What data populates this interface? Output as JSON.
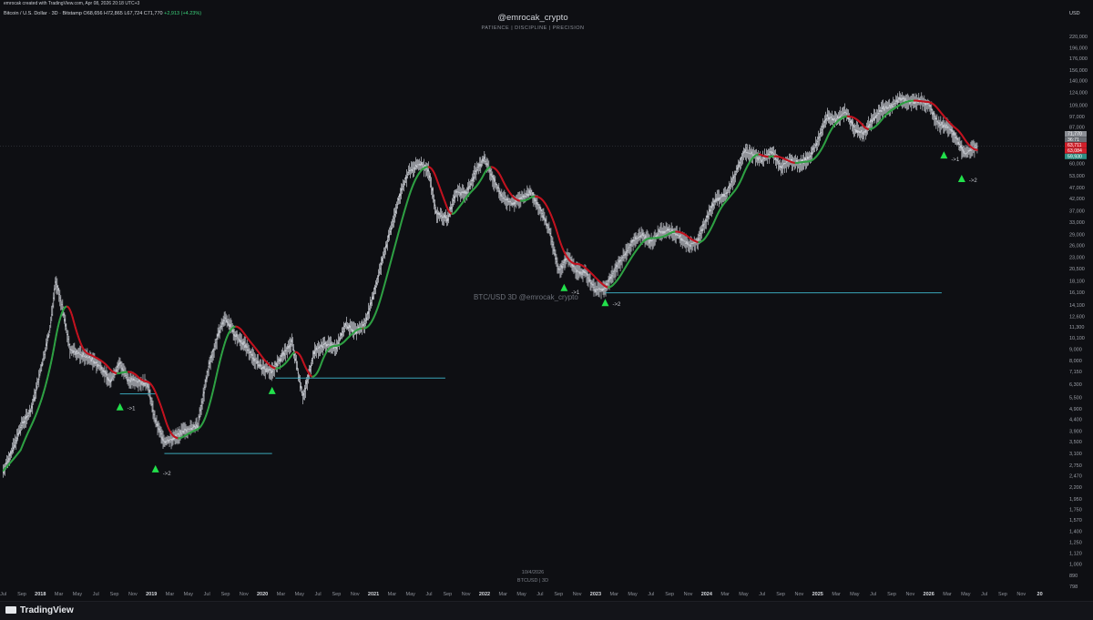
{
  "top_bar": {
    "caption": "emrocak created with TradingView.com, Apr 08, 2026 20:18 UTC+3"
  },
  "headline": {
    "symbol": "Bitcoin / U.S. Dollar · 3D · Bitstamp",
    "ohlc": "O68,656 H72,865 L67,724 C71,770",
    "change": "+2,913 (+4.23%)"
  },
  "watermark": {
    "title": "@emrocak_crypto",
    "subtitle": "PATIENCE | DISCIPLINE | PRECISION"
  },
  "center_mark": "BTC/USD 3D  @emrocak_crypto",
  "date_mark": {
    "date": "10/4/2026",
    "symbol": "BTCUSD | 3D"
  },
  "currency": "USD",
  "footer": {
    "brand": "TradingView"
  },
  "colors": {
    "up": "#3bd07a",
    "bull_ma": "#2ea043",
    "bear_ma": "#c1121f",
    "level": "#3aa6b9",
    "marker": "#22e04b",
    "candles": "#c8cbd2"
  },
  "chart_data": {
    "type": "line",
    "scale": "log",
    "ylim": [
      720,
      280000
    ],
    "y_ticks": [
      "798",
      "890",
      "1,000",
      "1,120",
      "1,250",
      "1,400",
      "1,570",
      "1,750",
      "1,950",
      "2,200",
      "2,470",
      "2,750",
      "3,100",
      "3,500",
      "3,900",
      "4,400",
      "4,900",
      "5,500",
      "6,300",
      "7,150",
      "8,000",
      "9,000",
      "10,100",
      "11,300",
      "12,600",
      "14,100",
      "16,100",
      "18,100",
      "20,500",
      "23,000",
      "26,000",
      "29,000",
      "33,000",
      "37,000",
      "42,000",
      "47,000",
      "53,000",
      "60,000",
      "68,000",
      "77,000",
      "87,000",
      "97,000",
      "109,000",
      "124,000",
      "140,000",
      "156,000",
      "176,000",
      "196,000",
      "220,000"
    ],
    "x_ticks": [
      "Jul",
      "Sep",
      "2018",
      "Mar",
      "May",
      "Jul",
      "Sep",
      "Nov",
      "2019",
      "Mar",
      "May",
      "Jul",
      "Sep",
      "Nov",
      "2020",
      "Mar",
      "May",
      "Jul",
      "Sep",
      "Nov",
      "2021",
      "Mar",
      "May",
      "Jul",
      "Sep",
      "Nov",
      "2022",
      "Mar",
      "May",
      "Jul",
      "Sep",
      "Nov",
      "2023",
      "Mar",
      "May",
      "Jul",
      "Sep",
      "Nov",
      "2024",
      "Mar",
      "May",
      "Jul",
      "Sep",
      "Nov",
      "2025",
      "Mar",
      "May",
      "Jul",
      "Sep",
      "Nov",
      "2026",
      "Mar",
      "May",
      "Jul",
      "Sep",
      "Nov",
      "20"
    ],
    "price_labels": [
      {
        "text": "71,770",
        "color": "#8a8d94"
      },
      {
        "text": "36:71",
        "color": "#6c6f76"
      },
      {
        "text": "63,711",
        "color": "#d11f2a"
      },
      {
        "text": "63,084",
        "color": "#d11f2a"
      },
      {
        "text": "59,930",
        "color": "#2f8f84"
      }
    ],
    "markers": [
      "->1",
      "->2",
      "->1",
      "->2"
    ],
    "series": [
      {
        "values": [
          [
            2017.5,
            2600
          ],
          [
            2017.58,
            3200
          ],
          [
            2017.67,
            4200
          ],
          [
            2017.75,
            4800
          ],
          [
            2017.83,
            7000
          ],
          [
            2017.92,
            11000
          ],
          [
            2017.97,
            18000
          ],
          [
            2018.03,
            14000
          ],
          [
            2018.1,
            9000
          ],
          [
            2018.2,
            8500
          ],
          [
            2018.28,
            8200
          ],
          [
            2018.38,
            7500
          ],
          [
            2018.46,
            6500
          ],
          [
            2018.55,
            7800
          ],
          [
            2018.62,
            6600
          ],
          [
            2018.7,
            6500
          ],
          [
            2018.8,
            6300
          ],
          [
            2018.87,
            4300
          ],
          [
            2018.95,
            3500
          ],
          [
            2019.02,
            3600
          ],
          [
            2019.12,
            3900
          ],
          [
            2019.25,
            4100
          ],
          [
            2019.35,
            7500
          ],
          [
            2019.45,
            11000
          ],
          [
            2019.5,
            12500
          ],
          [
            2019.58,
            10500
          ],
          [
            2019.67,
            9500
          ],
          [
            2019.75,
            8300
          ],
          [
            2019.83,
            7400
          ],
          [
            2019.92,
            7200
          ],
          [
            2020.02,
            8500
          ],
          [
            2020.1,
            9700
          ],
          [
            2020.2,
            5500
          ],
          [
            2020.3,
            8800
          ],
          [
            2020.4,
            9500
          ],
          [
            2020.5,
            9200
          ],
          [
            2020.58,
            11500
          ],
          [
            2020.67,
            10800
          ],
          [
            2020.75,
            11500
          ],
          [
            2020.83,
            15500
          ],
          [
            2020.92,
            23000
          ],
          [
            2021.0,
            32000
          ],
          [
            2021.08,
            45000
          ],
          [
            2021.15,
            55000
          ],
          [
            2021.25,
            60000
          ],
          [
            2021.33,
            56000
          ],
          [
            2021.4,
            36000
          ],
          [
            2021.5,
            34000
          ],
          [
            2021.58,
            45000
          ],
          [
            2021.67,
            44000
          ],
          [
            2021.75,
            55000
          ],
          [
            2021.83,
            63000
          ],
          [
            2021.92,
            50000
          ],
          [
            2022.0,
            42000
          ],
          [
            2022.08,
            40000
          ],
          [
            2022.17,
            42000
          ],
          [
            2022.25,
            45000
          ],
          [
            2022.33,
            38000
          ],
          [
            2022.42,
            30000
          ],
          [
            2022.5,
            20000
          ],
          [
            2022.58,
            23000
          ],
          [
            2022.67,
            20000
          ],
          [
            2022.75,
            19500
          ],
          [
            2022.83,
            16500
          ],
          [
            2022.92,
            16800
          ],
          [
            2023.0,
            20000
          ],
          [
            2023.08,
            23000
          ],
          [
            2023.17,
            27000
          ],
          [
            2023.25,
            29000
          ],
          [
            2023.33,
            27000
          ],
          [
            2023.42,
            30000
          ],
          [
            2023.5,
            30200
          ],
          [
            2023.58,
            29000
          ],
          [
            2023.67,
            26000
          ],
          [
            2023.75,
            27000
          ],
          [
            2023.83,
            34000
          ],
          [
            2023.92,
            42000
          ],
          [
            2024.0,
            43000
          ],
          [
            2024.08,
            52000
          ],
          [
            2024.17,
            68000
          ],
          [
            2024.25,
            66000
          ],
          [
            2024.33,
            62000
          ],
          [
            2024.42,
            68000
          ],
          [
            2024.5,
            58000
          ],
          [
            2024.58,
            62000
          ],
          [
            2024.67,
            60000
          ],
          [
            2024.75,
            63000
          ],
          [
            2024.83,
            75000
          ],
          [
            2024.92,
            97000
          ],
          [
            2025.0,
            94000
          ],
          [
            2025.08,
            102000
          ],
          [
            2025.17,
            85000
          ],
          [
            2025.25,
            82000
          ],
          [
            2025.33,
            95000
          ],
          [
            2025.42,
            105000
          ],
          [
            2025.5,
            108000
          ],
          [
            2025.58,
            117000
          ],
          [
            2025.67,
            112000
          ],
          [
            2025.75,
            114000
          ],
          [
            2025.83,
            110000
          ],
          [
            2025.92,
            90000
          ],
          [
            2026.0,
            88000
          ],
          [
            2026.08,
            78000
          ],
          [
            2026.15,
            66000
          ],
          [
            2026.22,
            69000
          ],
          [
            2026.27,
            71770
          ]
        ]
      }
    ],
    "levels": [
      {
        "price": 5700
      },
      {
        "price": 3100
      },
      {
        "price": 6700
      },
      {
        "price": 16000
      }
    ]
  }
}
